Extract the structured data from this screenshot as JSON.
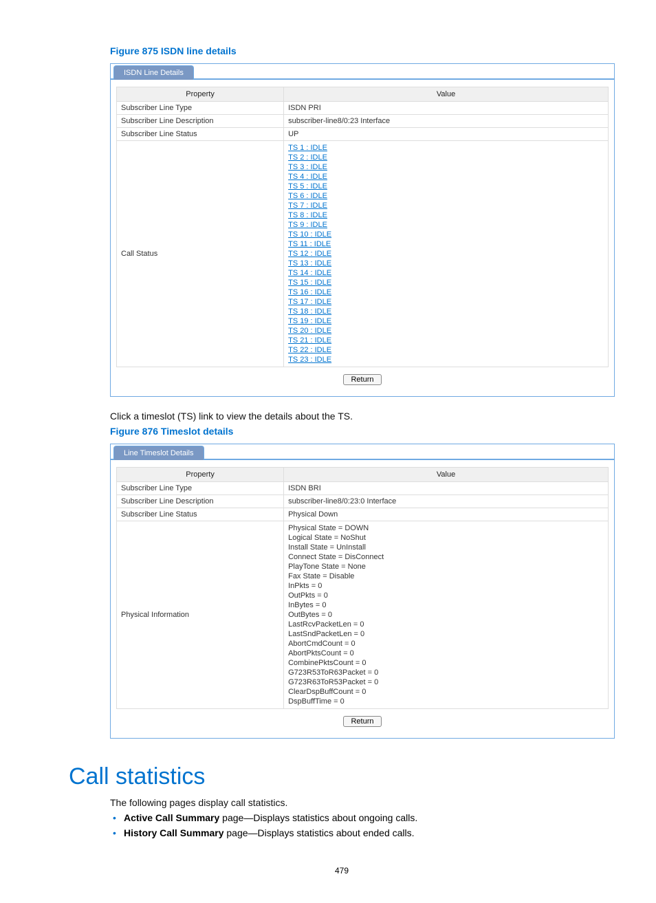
{
  "figure1": {
    "title": "Figure 875 ISDN line details",
    "tab": "ISDN Line Details",
    "headers": {
      "prop": "Property",
      "val": "Value"
    },
    "rows": [
      {
        "prop": "Subscriber Line Type",
        "val": "ISDN PRI"
      },
      {
        "prop": "Subscriber Line Description",
        "val": "subscriber-line8/0:23 Interface"
      },
      {
        "prop": "Subscriber Line Status",
        "val": "UP"
      }
    ],
    "callStatusLabel": "Call Status",
    "timeslots": [
      "TS 1 : IDLE",
      "TS 2 : IDLE",
      "TS 3 : IDLE",
      "TS 4 : IDLE",
      "TS 5 : IDLE",
      "TS 6 : IDLE",
      "TS 7 : IDLE",
      "TS 8 : IDLE",
      "TS 9 : IDLE",
      "TS 10 : IDLE",
      "TS 11 : IDLE",
      "TS 12 : IDLE",
      "TS 13 : IDLE",
      "TS 14 : IDLE",
      "TS 15 : IDLE",
      "TS 16 : IDLE",
      "TS 17 : IDLE",
      "TS 18 : IDLE",
      "TS 19 : IDLE",
      "TS 20 : IDLE",
      "TS 21 : IDLE",
      "TS 22 : IDLE",
      "TS 23 : IDLE"
    ],
    "returnLabel": "Return"
  },
  "intertext": "Click a timeslot (TS) link to view the details about the TS.",
  "figure2": {
    "title": "Figure 876 Timeslot details",
    "tab": "Line Timeslot Details",
    "headers": {
      "prop": "Property",
      "val": "Value"
    },
    "rows": [
      {
        "prop": "Subscriber Line Type",
        "val": "ISDN BRI"
      },
      {
        "prop": "Subscriber Line Description",
        "val": "subscriber-line8/0:23:0 Interface"
      },
      {
        "prop": "Subscriber Line Status",
        "val": "Physical Down"
      }
    ],
    "physLabel": "Physical Information",
    "physLines": [
      "Physical State = DOWN",
      "Logical State = NoShut",
      "Install State = UnInstall",
      "Connect State = DisConnect",
      "PlayTone State = None",
      "Fax State = Disable",
      "InPkts = 0",
      "OutPkts = 0",
      "InBytes = 0",
      "OutBytes = 0",
      "LastRcvPacketLen = 0",
      "LastSndPacketLen = 0",
      "AbortCmdCount = 0",
      "AbortPktsCount = 0",
      "CombinePktsCount = 0",
      "G723R53ToR63Packet = 0",
      "G723R63ToR53Packet = 0",
      "ClearDspBuffCount = 0",
      "DspBuffTime = 0"
    ],
    "returnLabel": "Return"
  },
  "section": {
    "title": "Call statistics",
    "intro": "The following pages display call statistics.",
    "bullets": [
      {
        "bold": "Active Call Summary",
        "rest": " page—Displays statistics about ongoing calls."
      },
      {
        "bold": "History Call Summary",
        "rest": " page—Displays statistics about ended calls."
      }
    ]
  },
  "pageNumber": "479"
}
